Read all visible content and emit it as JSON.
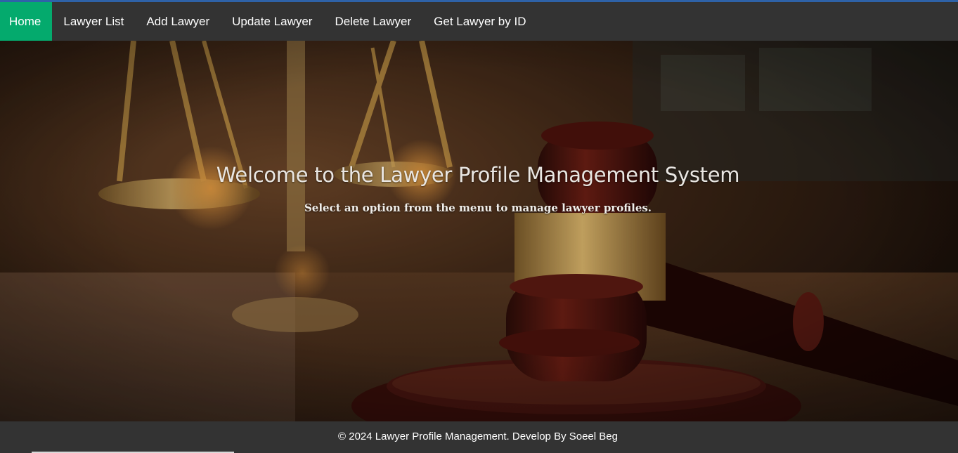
{
  "nav": {
    "items": [
      {
        "label": "Home",
        "active": true
      },
      {
        "label": "Lawyer List",
        "active": false
      },
      {
        "label": "Add Lawyer",
        "active": false
      },
      {
        "label": "Update Lawyer",
        "active": false
      },
      {
        "label": "Delete Lawyer",
        "active": false
      },
      {
        "label": "Get Lawyer by ID",
        "active": false
      }
    ]
  },
  "hero": {
    "title": "Welcome to the Lawyer Profile Management System",
    "subtitle": "Select an option from the menu to manage lawyer profiles.",
    "background_image": "gavel-and-scales-of-justice"
  },
  "footer": {
    "text": "© 2024 Lawyer Profile Management. Develop By Soeel Beg"
  },
  "colors": {
    "nav_bg": "#333333",
    "nav_active": "#04aa6d",
    "footer_bg": "#333333",
    "top_accent": "#2e62a8"
  }
}
